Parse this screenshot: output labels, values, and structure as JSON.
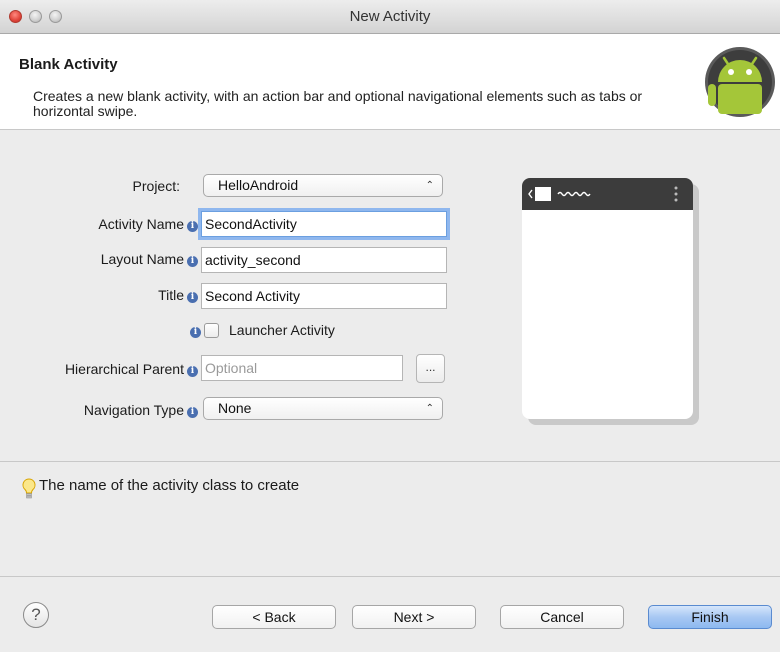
{
  "window": {
    "title": "New Activity"
  },
  "header": {
    "title": "Blank Activity",
    "description": "Creates a new blank activity, with an action bar and optional navigational elements such as tabs or horizontal swipe."
  },
  "form": {
    "project": {
      "label": "Project:",
      "value": "HelloAndroid"
    },
    "activity_name": {
      "label": "Activity Name",
      "value": "SecondActivity"
    },
    "layout_name": {
      "label": "Layout Name",
      "value": "activity_second"
    },
    "title": {
      "label": "Title",
      "value": "Second Activity"
    },
    "launcher_activity": {
      "label": "Launcher Activity",
      "checked": false
    },
    "hierarchical_parent": {
      "label": "Hierarchical Parent",
      "placeholder": "Optional",
      "browse_label": "..."
    },
    "navigation_type": {
      "label": "Navigation Type",
      "value": "None"
    }
  },
  "message": {
    "text": "The name of the activity class to create",
    "icon": "lightbulb-icon"
  },
  "buttons": {
    "help": "?",
    "back": "< Back",
    "next": "Next >",
    "cancel": "Cancel",
    "finish": "Finish"
  },
  "icons": {
    "info": "i",
    "select_arrows": "⌃⌄"
  },
  "colors": {
    "accent": "#8db9f0",
    "focus_ring": "#8fb7ee",
    "android_green": "#a4c639"
  }
}
